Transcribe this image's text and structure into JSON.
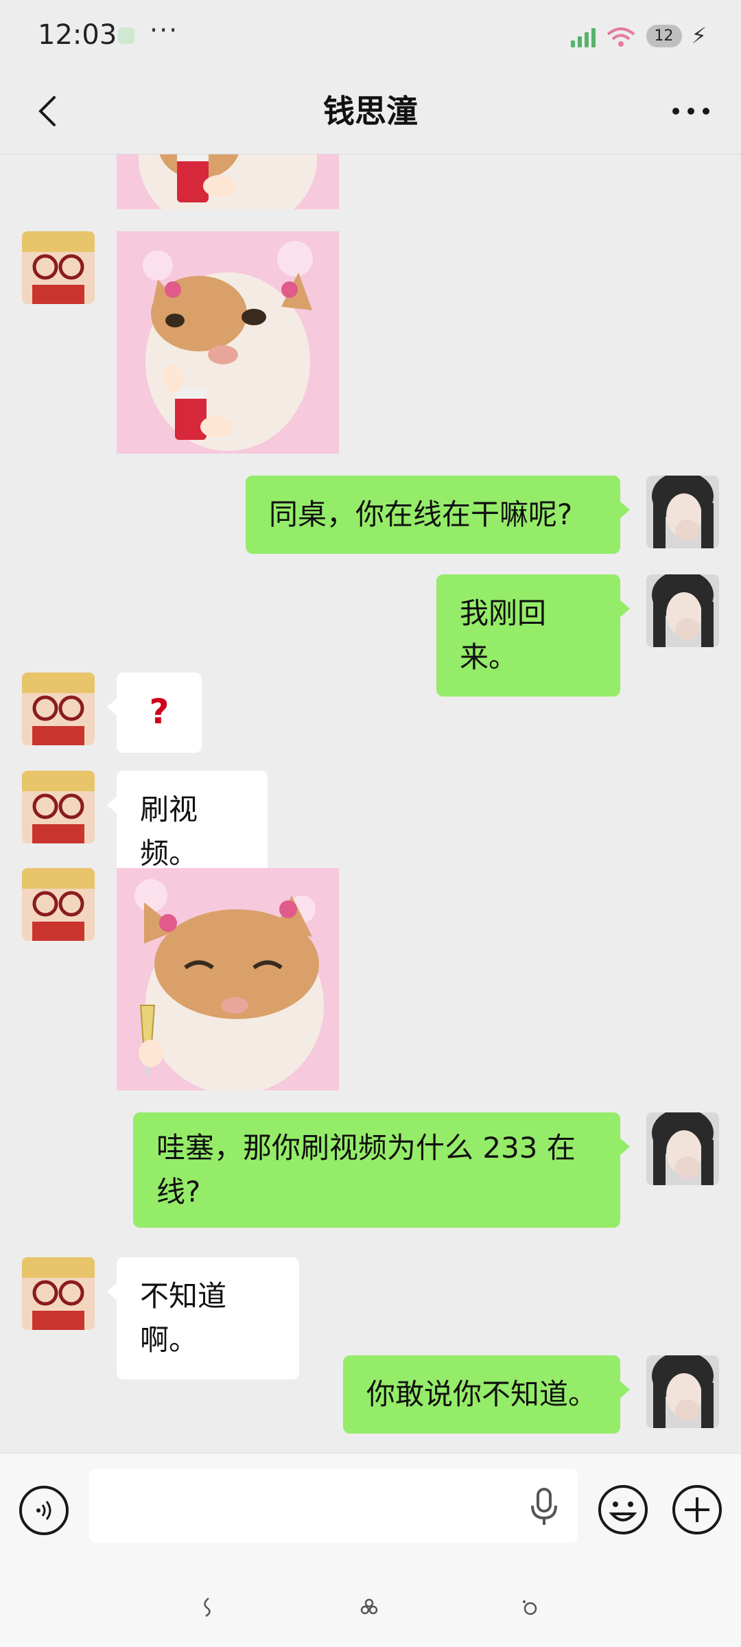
{
  "status_bar": {
    "time": "12:03",
    "dots": "···",
    "battery_badge": "12",
    "signal_color": "#56b36c"
  },
  "header": {
    "title": "钱思潼",
    "back_icon": "chevron-left-icon",
    "more_icon": "more-dots-icon"
  },
  "messages": [
    {
      "side": "left",
      "type": "sticker",
      "description_icon": "cat-sticker"
    },
    {
      "side": "left",
      "type": "sticker",
      "description_icon": "cat-sticker"
    },
    {
      "side": "right",
      "type": "text",
      "text": "同桌，你在线在干嘛呢?"
    },
    {
      "side": "right",
      "type": "text",
      "text": "我刚回来。"
    },
    {
      "side": "left",
      "type": "text",
      "text": "?"
    },
    {
      "side": "left",
      "type": "text",
      "text": "刷视频。"
    },
    {
      "side": "left",
      "type": "sticker",
      "description_icon": "cat-sticker"
    },
    {
      "side": "right",
      "type": "text",
      "text": "哇塞，那你刷视频为什么 233 在线?"
    },
    {
      "side": "left",
      "type": "text",
      "text": "不知道啊。"
    },
    {
      "side": "right",
      "type": "text",
      "text": "你敢说你不知道。"
    }
  ],
  "input_bar": {
    "placeholder": "",
    "voice_icon": "voice-toggle-icon",
    "mic_icon": "microphone-icon",
    "emoji_icon": "emoji-icon",
    "plus_icon": "plus-icon"
  },
  "colors": {
    "green_bubble": "#95ec69",
    "background": "#ededed"
  }
}
